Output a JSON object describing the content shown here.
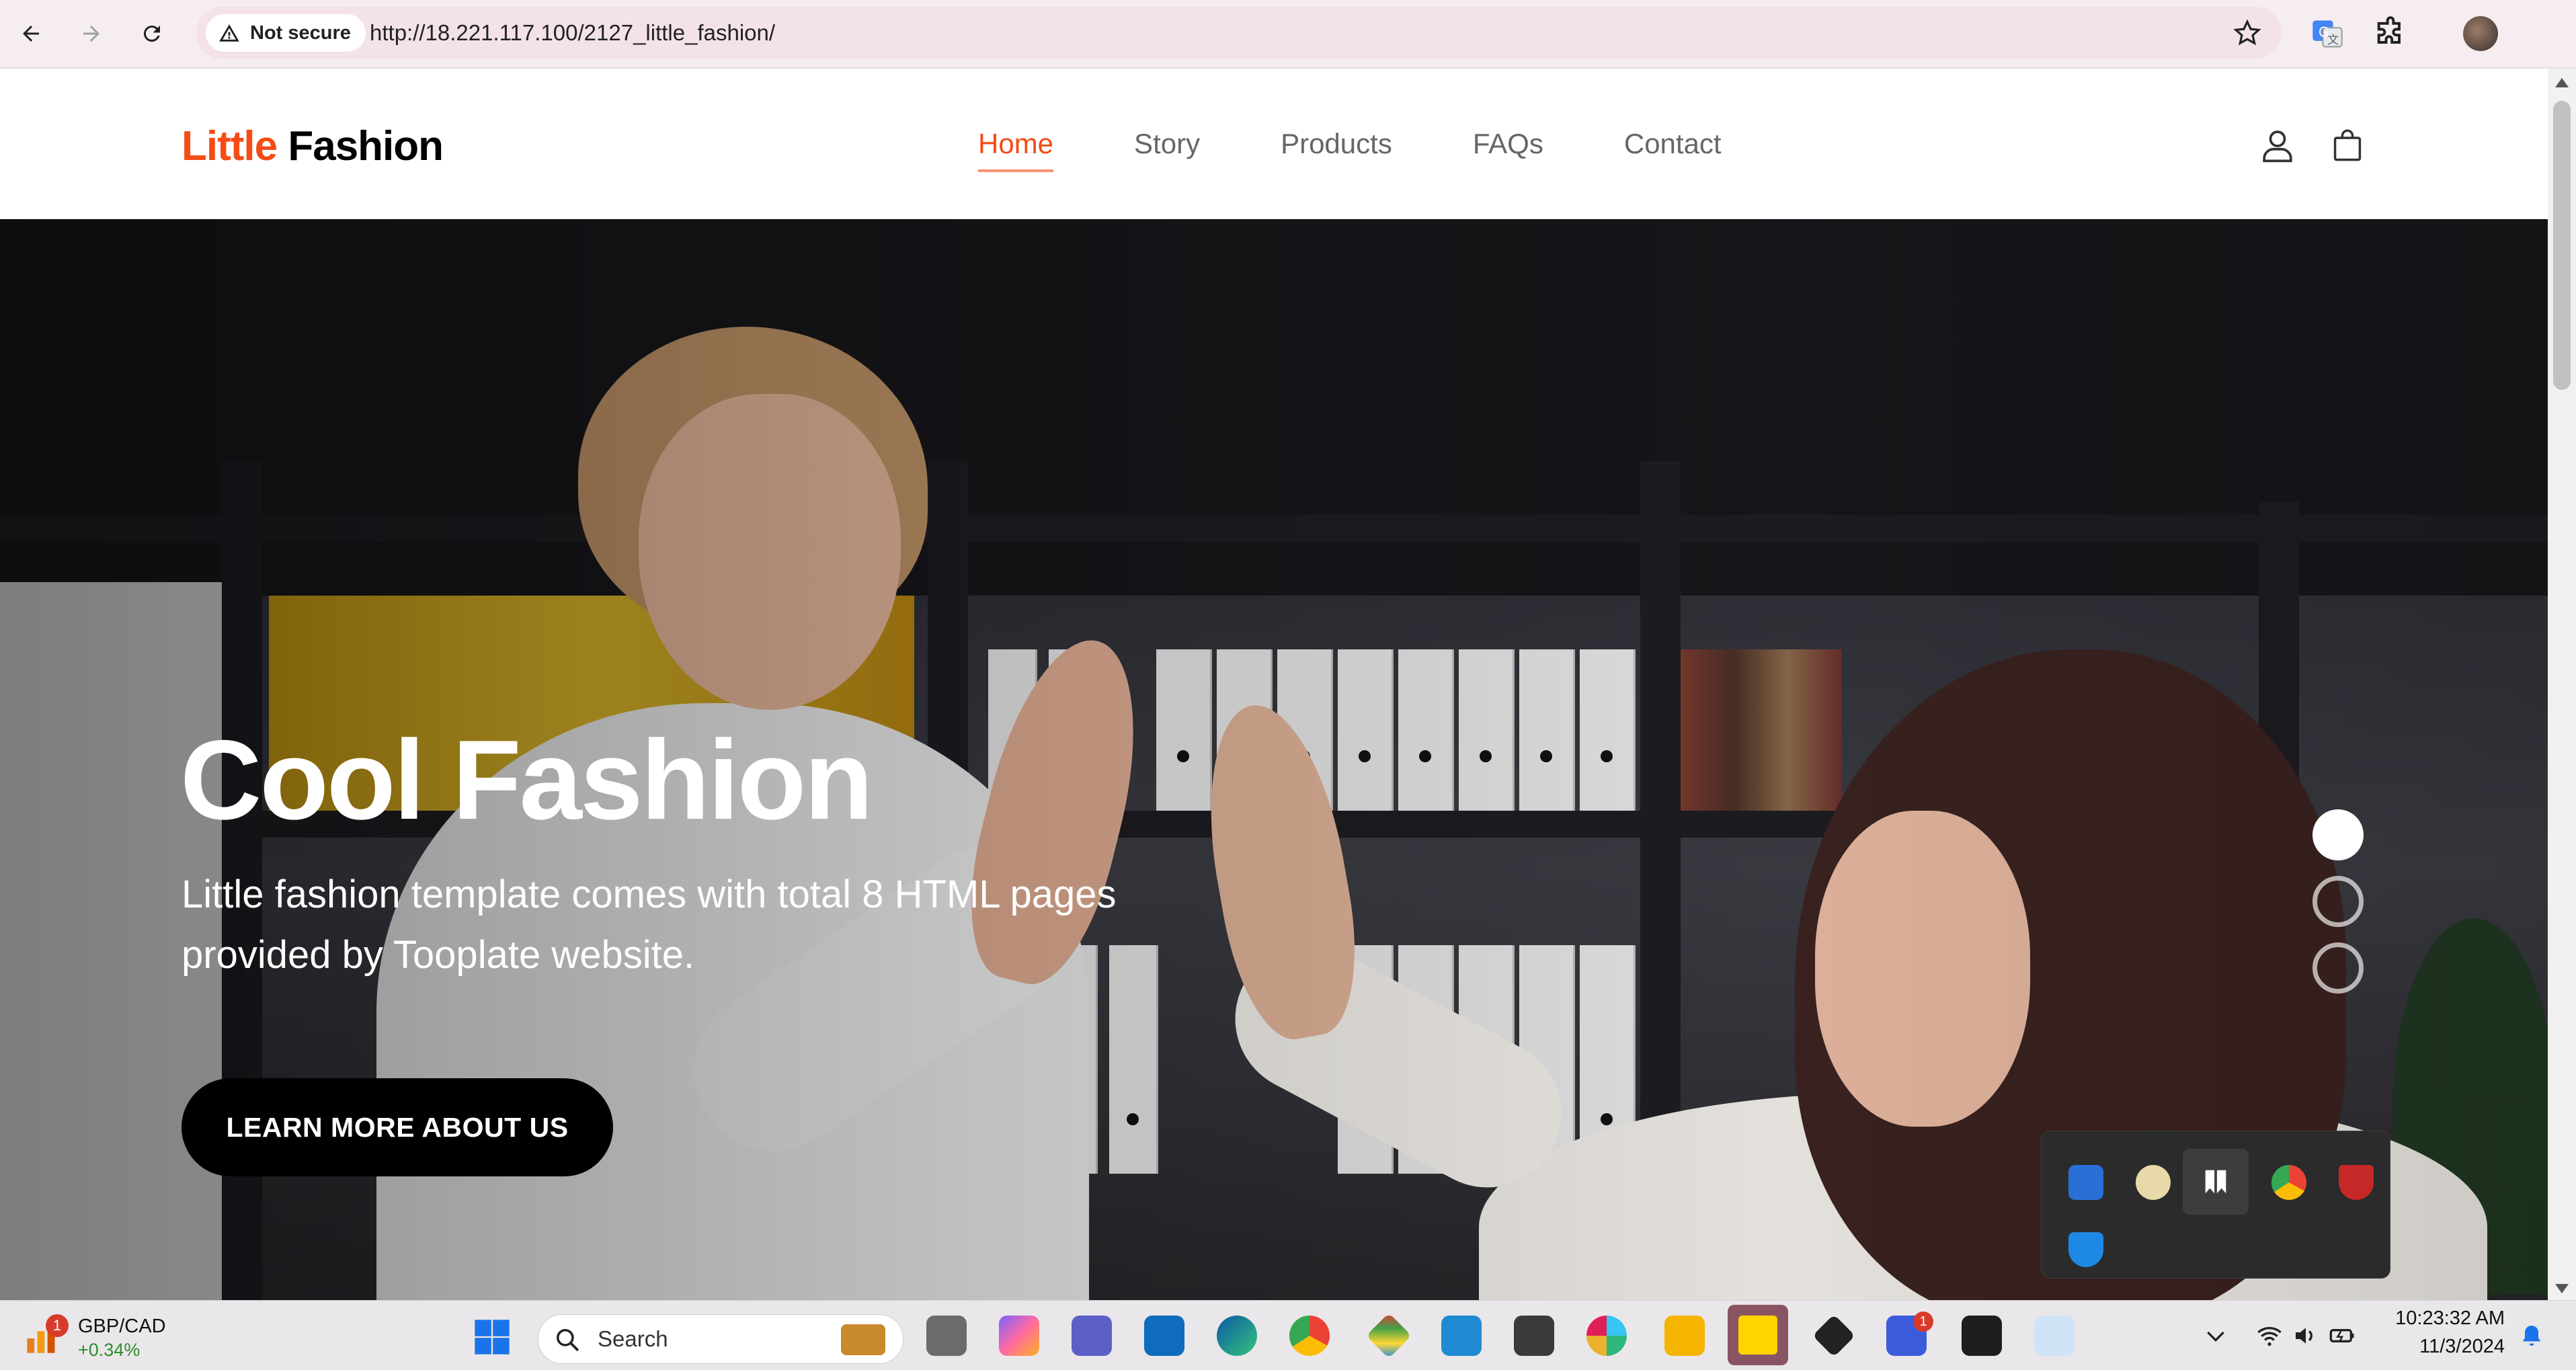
{
  "browser": {
    "security_label": "Not secure",
    "url": "http://18.221.117.100/2127_little_fashion/"
  },
  "site": {
    "brand_accent": "Little",
    "brand_main": "Fashion",
    "nav": [
      {
        "label": "Home",
        "active": true
      },
      {
        "label": "Story"
      },
      {
        "label": "Products"
      },
      {
        "label": "FAQs"
      },
      {
        "label": "Contact"
      }
    ],
    "icons": {
      "account": "user-icon",
      "cart": "shopping-bag-icon"
    }
  },
  "hero": {
    "title": "Cool Fashion",
    "text": "Little fashion template comes with total 8 HTML pages provided by Tooplate website.",
    "cta": "LEARN MORE ABOUT US",
    "slides": 3,
    "active_slide": 1
  },
  "taskbar": {
    "widget": {
      "pair": "GBP/CAD",
      "change": "+0.34%",
      "badge": "1"
    },
    "search_label": "Search",
    "teams_badge": "1",
    "time": "10:23:32 AM",
    "date": "11/3/2024"
  },
  "colors": {
    "accent": "#f54b14",
    "cta": "#000000",
    "hero_text": "#ffffff"
  }
}
